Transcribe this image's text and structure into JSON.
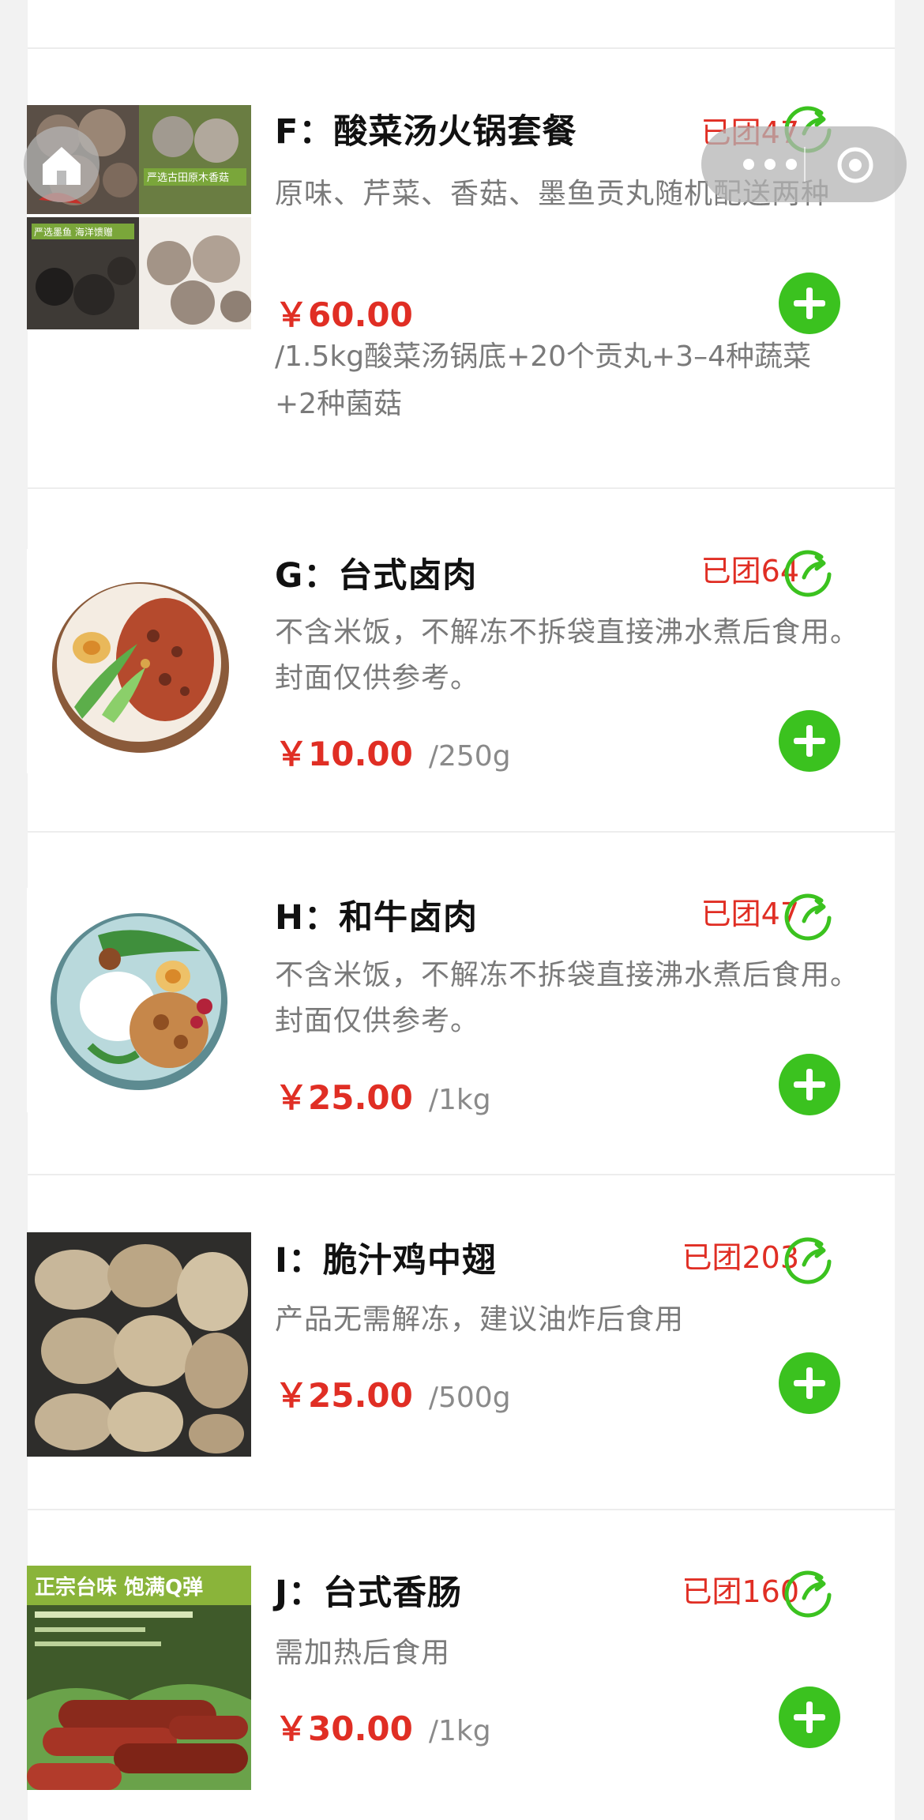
{
  "colors": {
    "accent_red": "#e02e24",
    "accent_green": "#3bc21f",
    "background": "#f2f2f2"
  },
  "products": [
    {
      "title": "F：酸菜汤火锅套餐",
      "group_count": "已团47",
      "description": "原味、芹菜、香菇、墨鱼贡丸随机配送两种",
      "price": "￥60.00",
      "unit": "/1.5kg酸菜汤锅底+20个贡丸+3–4种蔬菜+2种菌菇",
      "thumb_texts": [
        "严选古田原木香菇",
        "严选墨鱼 海洋馈赠"
      ]
    },
    {
      "title": "G：台式卤肉",
      "group_count": "已团64",
      "description": "不含米饭，不解冻不拆袋直接沸水煮后食用。封面仅供参考。",
      "price": "￥10.00",
      "unit": "/250g"
    },
    {
      "title": "H：和牛卤肉",
      "group_count": "已团47",
      "description": "不含米饭，不解冻不拆袋直接沸水煮后食用。封面仅供参考。",
      "price": "￥25.00",
      "unit": "/1kg"
    },
    {
      "title": "I：脆汁鸡中翅",
      "group_count": "已团203",
      "description": "产品无需解冻，建议油炸后食用",
      "price": "￥25.00",
      "unit": "/500g"
    },
    {
      "title": "J：台式香肠",
      "group_count": "已团160",
      "description": "需加热后食用",
      "price": "￥30.00",
      "unit": "/1kg",
      "thumb_texts": [
        "正宗台味 饱满Q弹"
      ]
    }
  ]
}
